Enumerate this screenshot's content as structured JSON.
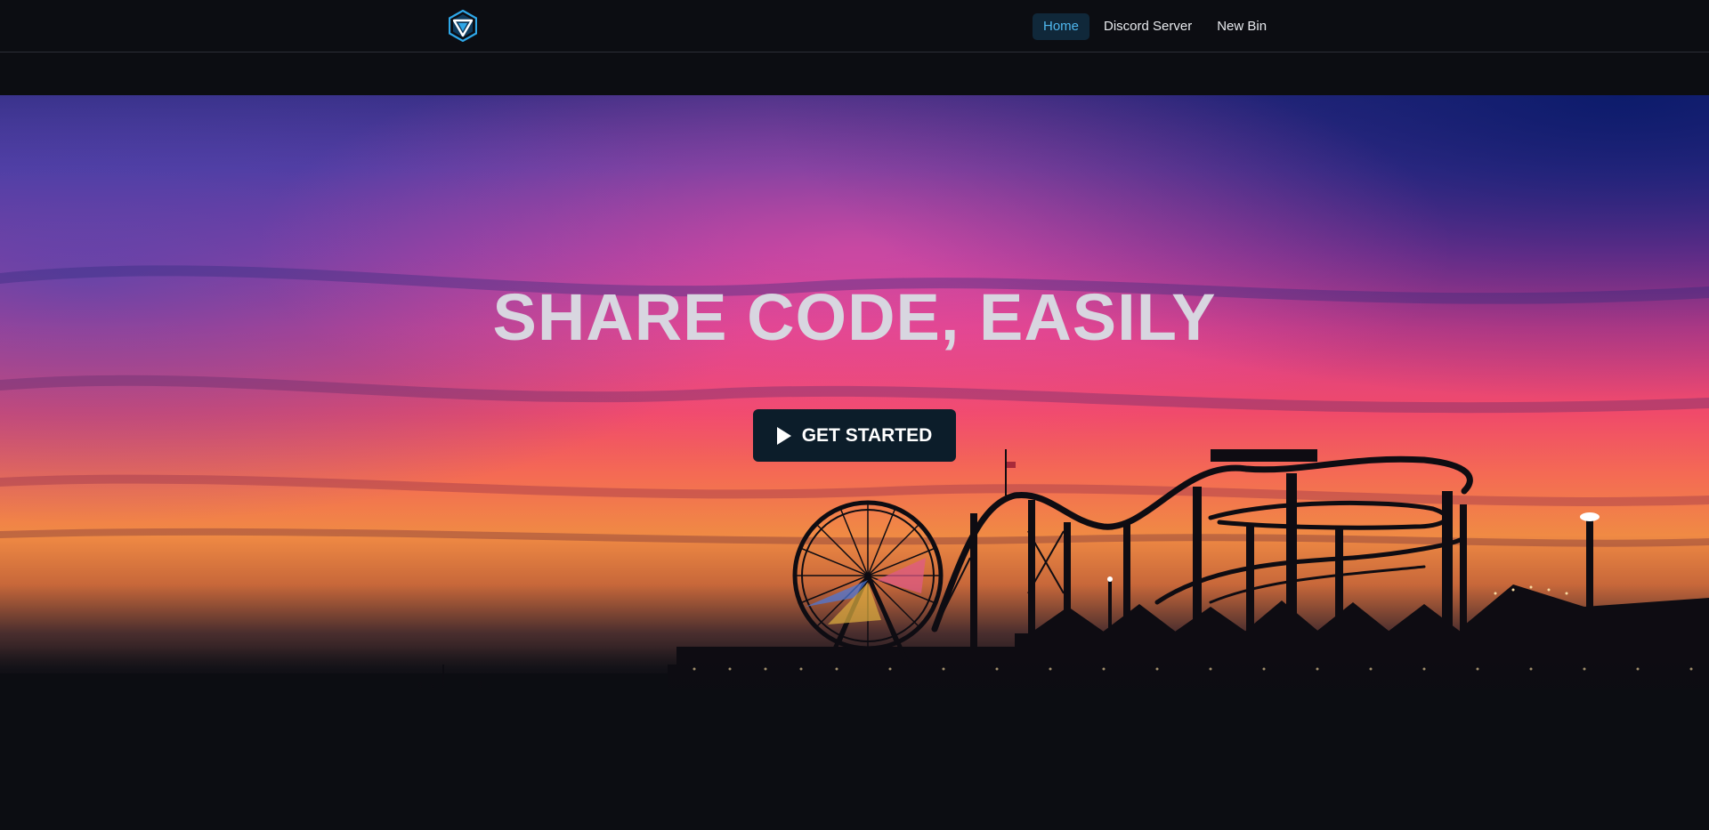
{
  "nav": {
    "logo_icon": "hexagon-triangle-logo-icon",
    "links": [
      {
        "label": "Home",
        "active": true
      },
      {
        "label": "Discord Server",
        "active": false
      },
      {
        "label": "New Bin",
        "active": false
      }
    ]
  },
  "hero": {
    "background": "sunset-pier-ferris-wheel-roller-coaster-photo",
    "title": "SHARE CODE, EASILY",
    "cta_label": "GET STARTED",
    "cta_icon": "play-icon"
  },
  "colors": {
    "background": "#0c0d12",
    "nav_active_bg": "#10283a",
    "nav_active_text": "#4fb7ee",
    "cta_bg": "#0c1d2a",
    "logo_blue": "#2ea7e8"
  }
}
